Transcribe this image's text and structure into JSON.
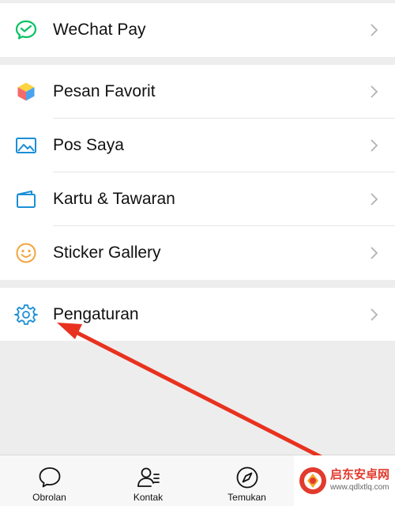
{
  "menu": {
    "pay": {
      "label": "WeChat Pay",
      "icon": "wechat-pay-icon"
    },
    "items": [
      {
        "label": "Pesan Favorit",
        "icon": "favorites-cube-icon"
      },
      {
        "label": "Pos Saya",
        "icon": "photo-icon"
      },
      {
        "label": "Kartu & Tawaran",
        "icon": "card-icon"
      },
      {
        "label": "Sticker Gallery",
        "icon": "smiley-icon"
      }
    ],
    "settings": {
      "label": "Pengaturan",
      "icon": "gear-icon"
    }
  },
  "tabbar": {
    "tabs": [
      {
        "label": "Obrolan",
        "icon": "chat-bubble-icon"
      },
      {
        "label": "Kontak",
        "icon": "contacts-icon"
      },
      {
        "label": "Temukan",
        "icon": "compass-icon"
      }
    ]
  },
  "watermark": {
    "title": "启东安卓网",
    "url": "www.qdlxtlq.com"
  },
  "colors": {
    "wechat_green": "#07c160",
    "accent_blue": "#1a8fd6",
    "arrow_red": "#e8321f"
  }
}
